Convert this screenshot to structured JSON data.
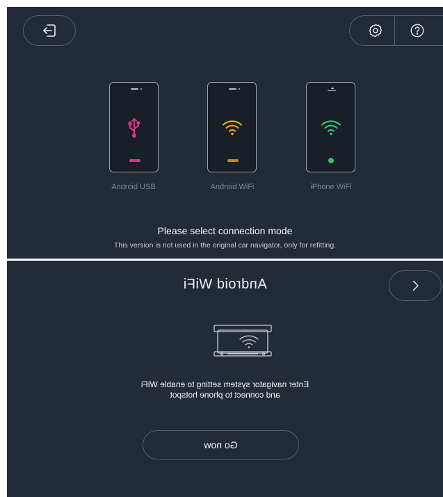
{
  "top": {
    "modes": [
      {
        "label": "Android USB",
        "icon": "usb-icon",
        "accent": "#e2328c"
      },
      {
        "label": "Android WiFi",
        "icon": "wifi-icon",
        "accent": "#e8a524"
      },
      {
        "label": "iPhone WiFi",
        "icon": "wifi-icon",
        "accent": "#2ec66d"
      }
    ],
    "prompt_title": "Please select connection mode",
    "prompt_sub": "This version is not used in the original car navigator, only for refitting."
  },
  "bottom": {
    "title": "Android WiFi",
    "instruction_line1": "Enter navigator system setting to enable WiFi",
    "instruction_line2": "and connect to phone hotspot",
    "go_label": "Go now"
  },
  "icons": {
    "back": "exit-icon",
    "settings": "gear-icon",
    "help": "help-icon",
    "next": "chevron-right-icon"
  }
}
